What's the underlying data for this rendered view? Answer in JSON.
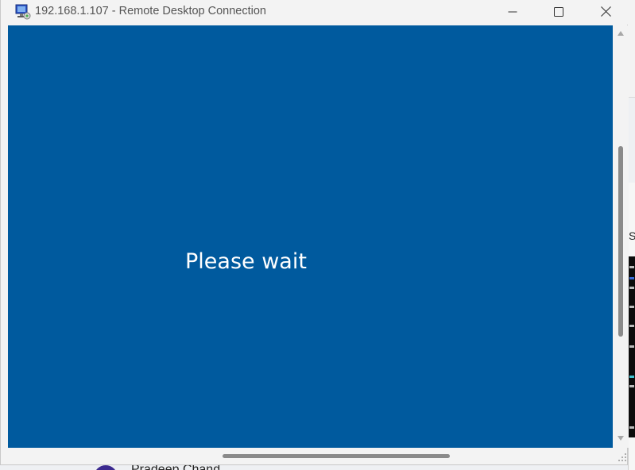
{
  "window": {
    "title": "192.168.1.107 - Remote Desktop Connection",
    "icon": "remote-desktop-icon",
    "controls": [
      "minimize-icon",
      "maximize-icon",
      "close-icon"
    ]
  },
  "remote_session": {
    "status_text": "Please wait",
    "background_color": "#005a9e"
  },
  "background": {
    "right_panel_letter": "S",
    "bottom_user_name": "Pradeep Chand"
  }
}
